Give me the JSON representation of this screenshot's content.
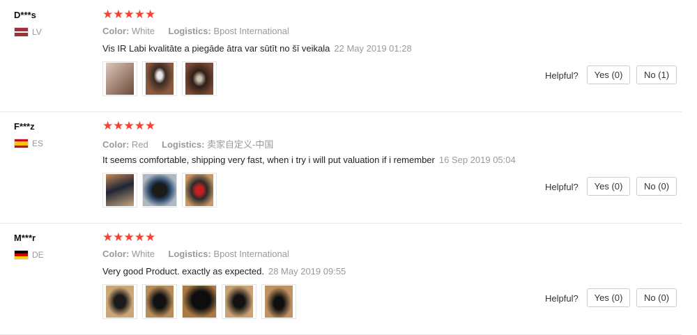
{
  "helpful_label": "Helpful?",
  "reviews": [
    {
      "user": "D***s",
      "country": "LV",
      "stars": "★★★★★",
      "color_key": "Color:",
      "color_value": "White",
      "logistics_key": "Logistics:",
      "logistics_value": "Bpost International",
      "text": "Vis IR Labi kvalitāte a piegāde ātra var sūtīt no šī veikala",
      "date": "22 May 2019 01:28",
      "yes": "Yes (0)",
      "no": "No (1)"
    },
    {
      "user": "F***z",
      "country": "ES",
      "stars": "★★★★★",
      "color_key": "Color:",
      "color_value": "Red",
      "logistics_key": "Logistics:",
      "logistics_value": "卖家自定义-中国",
      "text": "It seems comfortable, shipping very fast, when i try i will put valuation if i remember",
      "date": "16 Sep 2019 05:04",
      "yes": "Yes (0)",
      "no": "No (0)"
    },
    {
      "user": "M***r",
      "country": "DE",
      "stars": "★★★★★",
      "color_key": "Color:",
      "color_value": "White",
      "logistics_key": "Logistics:",
      "logistics_value": "Bpost International",
      "text": "Very good Product. exactly as expected.",
      "date": "28 May 2019 09:55",
      "yes": "Yes (0)",
      "no": "No (0)"
    }
  ],
  "colors": {
    "star": "#f44336",
    "muted": "#999999",
    "border": "#e8e8e8"
  }
}
